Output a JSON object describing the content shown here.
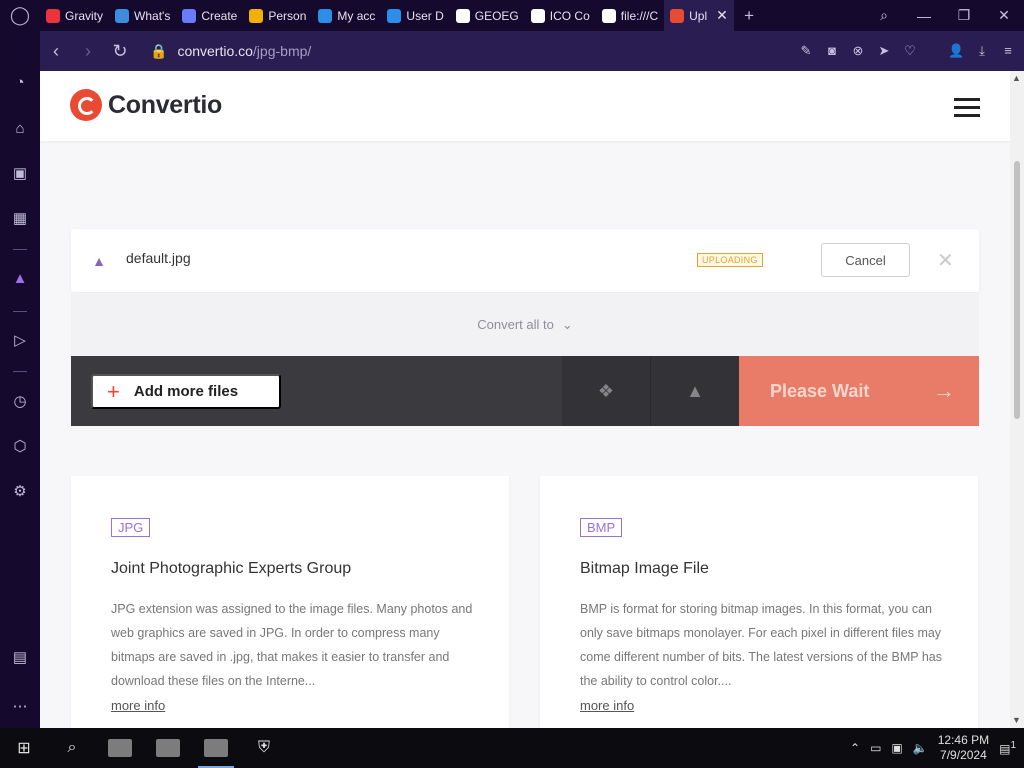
{
  "browser": {
    "tabs": [
      {
        "label": "Gravity",
        "color": "#e8343a"
      },
      {
        "label": "What's",
        "color": "#3b8de0"
      },
      {
        "label": "Create",
        "color": "#6a7bff"
      },
      {
        "label": "Person",
        "color": "#f0b100"
      },
      {
        "label": "My acc",
        "color": "#2c8ee8"
      },
      {
        "label": "User D",
        "color": "#2c8ee8"
      },
      {
        "label": "GEOEG",
        "color": "#ffffff"
      },
      {
        "label": "ICO Co",
        "color": "#ffffff"
      },
      {
        "label": "file:///C",
        "color": "#ffffff"
      },
      {
        "label": "Upl",
        "color": "#e84a33"
      }
    ],
    "url_host": "convertio.co",
    "url_path": "/jpg-bmp/"
  },
  "site": {
    "brand": "Convertio",
    "file": {
      "name": "default.jpg",
      "status": "UPLOADING",
      "cancel_label": "Cancel"
    },
    "convert_all_label": "Convert all to",
    "add_files_label": "Add more files",
    "wait_label": "Please Wait"
  },
  "cards": [
    {
      "tag": "JPG",
      "title": "Joint Photographic Experts Group",
      "text": "JPG extension was assigned to the image files. Many photos and web graphics are saved in JPG. In order to compress many bitmaps are saved in .jpg, that makes it easier to transfer and download these files on the Interne...",
      "more": "more info"
    },
    {
      "tag": "BMP",
      "title": "Bitmap Image File",
      "text": "BMP is format for storing bitmap images. In this format, you can only save bitmaps monolayer. For each pixel in different files may come different number of bits. The latest versions of the BMP has the ability to control color....",
      "more": "more info"
    }
  ],
  "taskbar": {
    "time": "12:46 PM",
    "date": "7/9/2024",
    "notifications": "1"
  }
}
